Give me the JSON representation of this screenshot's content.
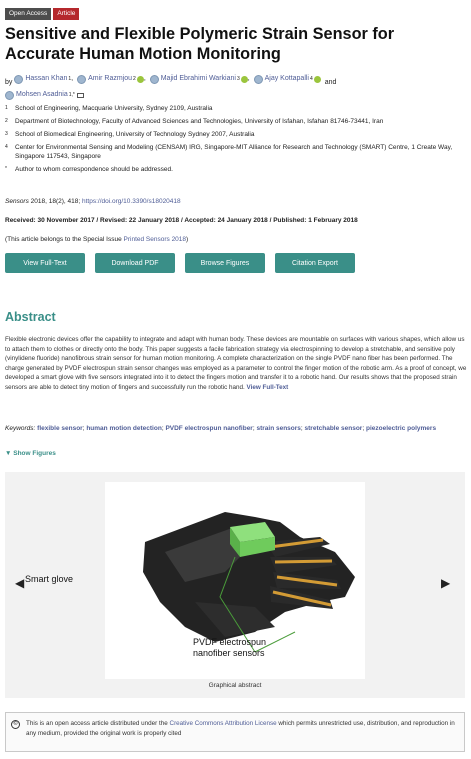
{
  "badges": {
    "open_access": "Open Access",
    "article": "Article"
  },
  "title": "Sensitive and Flexible Polymeric Strain Sensor for Accurate Human Motion Monitoring",
  "authors_prefix": "by",
  "authors": [
    {
      "name": "Hassan Khan",
      "sup": "1"
    },
    {
      "name": "Amir Razmjou",
      "sup": "2"
    },
    {
      "name": "Majid Ebrahimi Warkiani",
      "sup": "3"
    },
    {
      "name": "Ajay Kottapalli",
      "sup": "4"
    },
    {
      "name": "Mohsen Asadnia",
      "sup": "1,*"
    }
  ],
  "authors_and": "and",
  "affiliations": [
    {
      "num": "1",
      "text": "School of Engineering, Macquarie University, Sydney 2109, Australia"
    },
    {
      "num": "2",
      "text": "Department of Biotechnology, Faculty of Advanced Sciences and Technologies, University of Isfahan, Isfahan 81746-73441, Iran"
    },
    {
      "num": "3",
      "text": "School of Biomedical Engineering, University of Technology Sydney 2007, Australia"
    },
    {
      "num": "4",
      "text": "Center for Environmental Sensing and Modeling (CENSAM) IRG, Singapore-MIT Alliance for Research and Technology (SMART) Centre, 1 Create Way, Singapore 117543, Singapore"
    },
    {
      "num": "*",
      "text": "Author to whom correspondence should be addressed."
    }
  ],
  "citation": {
    "journal": "Sensors",
    "year_vol": " 2018, 18(2), 418; ",
    "doi": "https://doi.org/10.3390/s18020418"
  },
  "dates": "Received: 30 November 2017 / Revised: 22 January 2018 / Accepted: 24 January 2018 / Published: 1 February 2018",
  "special_issue": {
    "prefix": "(This article belongs to the Special Issue ",
    "link": "Printed Sensors 2018",
    "suffix": ")"
  },
  "buttons": [
    "View Full-Text",
    "Download PDF",
    "Browse Figures",
    "Citation Export"
  ],
  "abstract": {
    "heading": "Abstract",
    "text": "Flexible electronic devices offer the capability to integrate and adapt with human body. These devices are mountable on surfaces with various shapes, which allow us to attach them to clothes or directly onto the body. This paper suggests a facile fabrication strategy via electrospinning to develop a stretchable, and sensitive poly (vinylidene fluoride) nanofibrous strain sensor for human motion monitoring. A complete characterization on the single PVDF nano fiber has been performed. The charge generated by PVDF electrospun strain sensor changes was employed as a parameter to control the finger motion of the robotic arm. As a proof of concept, we developed a smart glove with five sensors integrated into it to detect the fingers motion and transfer it to a robotic hand. Our results shows that the proposed strain sensors are able to detect tiny motion of fingers and successfully run the robotic hand.",
    "link": "View Full-Text"
  },
  "keywords": {
    "label": "Keywords:",
    "items": [
      "flexible sensor",
      "human motion detection",
      "PVDF electrospun nanofiber",
      "strain sensors",
      "stretchable sensor",
      "piezoelectric polymers"
    ]
  },
  "show_figures": "▼ Show Figures",
  "figure": {
    "label_glove": "Smart glove",
    "label_sensor_1": "PVDF electrospun",
    "label_sensor_2": "nanofiber sensors",
    "caption": "Graphical abstract",
    "prev_arrow": "◀",
    "next_arrow": "▶"
  },
  "license": {
    "icon": "©",
    "prefix": "This is an open access article distributed under the ",
    "link": "Creative Commons Attribution License",
    "suffix": " which permits unrestricted use, distribution, and reproduction in any medium, provided the original work is properly cited"
  },
  "colors": {
    "teal": "#3a8f88",
    "link": "#4f5d96",
    "red_badge": "#b5282c"
  }
}
